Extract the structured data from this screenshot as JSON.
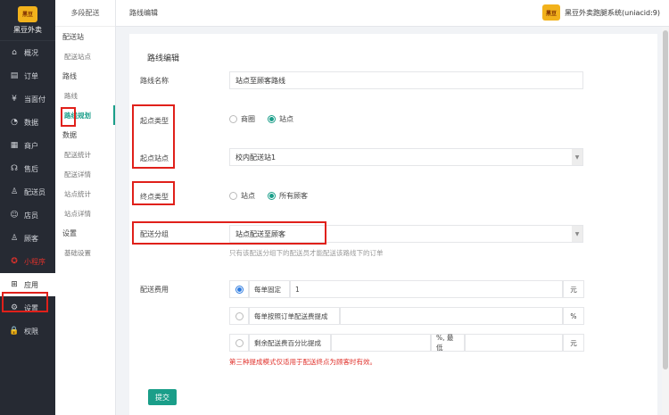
{
  "brand": {
    "logo_text": "黑豆",
    "name": "黑豆外卖"
  },
  "nav": [
    {
      "label": "概况",
      "icon": "home-icon",
      "glyph": "⌂"
    },
    {
      "label": "订单",
      "icon": "list-icon",
      "glyph": "▤"
    },
    {
      "label": "当面付",
      "icon": "coin-icon",
      "glyph": "¥"
    },
    {
      "label": "数据",
      "icon": "chart-icon",
      "glyph": "◔"
    },
    {
      "label": "商户",
      "icon": "store-icon",
      "glyph": "▦"
    },
    {
      "label": "售后",
      "icon": "headset-icon",
      "glyph": "☊"
    },
    {
      "label": "配送员",
      "icon": "rider-icon",
      "glyph": "♙"
    },
    {
      "label": "店员",
      "icon": "clerk-icon",
      "glyph": "☺"
    },
    {
      "label": "顾客",
      "icon": "customer-icon",
      "glyph": "♙"
    },
    {
      "label": "小程序",
      "icon": "miniprogram-icon",
      "glyph": "✪"
    },
    {
      "label": "应用",
      "icon": "apps-icon",
      "glyph": "⊞"
    },
    {
      "label": "设置",
      "icon": "gear-icon",
      "glyph": "⚙"
    },
    {
      "label": "权限",
      "icon": "lock-icon",
      "glyph": "🔒"
    }
  ],
  "subnav": {
    "title": "多段配送",
    "groups": [
      {
        "label": "配送站",
        "items": [
          "配送站点"
        ]
      },
      {
        "label": "路线",
        "items": [
          "路线",
          "路线规划"
        ]
      },
      {
        "label": "数据",
        "items": [
          "配送统计",
          "配送详情",
          "站点统计",
          "站点详情"
        ]
      },
      {
        "label": "设置",
        "items": [
          "基础设置"
        ]
      }
    ]
  },
  "topbar": {
    "title": "路线编辑",
    "account": "黑豆外卖跑腿系统(uniacid:9)"
  },
  "form": {
    "section_title": "路线编辑",
    "route_name": {
      "label": "路线名称",
      "value": "站点至顾客路线"
    },
    "start_type": {
      "label": "起点类型",
      "options": [
        "商圈",
        "站点"
      ],
      "selected": "站点"
    },
    "start_station": {
      "label": "起点站点",
      "value": "校内配送站1"
    },
    "end_type": {
      "label": "终点类型",
      "options": [
        "站点",
        "所有顾客"
      ],
      "selected": "所有顾客"
    },
    "group": {
      "label": "配送分组",
      "value": "站点配送至顾客",
      "help": "只有该配送分组下的配送员才能配送该路线下的订单"
    },
    "fee": {
      "label": "配送费用",
      "row1": {
        "name": "每单固定",
        "value": "1",
        "unit": "元"
      },
      "row2": {
        "name": "每单按照订单配送费提成",
        "value": "",
        "unit": "%"
      },
      "row3": {
        "name": "剩余配送费百分比提成",
        "value": "",
        "mid": "%, 最低",
        "value2": "",
        "unit": "元"
      },
      "warning": "第三种提成模式仅适用于配送终点为顾客时有效。"
    },
    "submit": "提交"
  }
}
